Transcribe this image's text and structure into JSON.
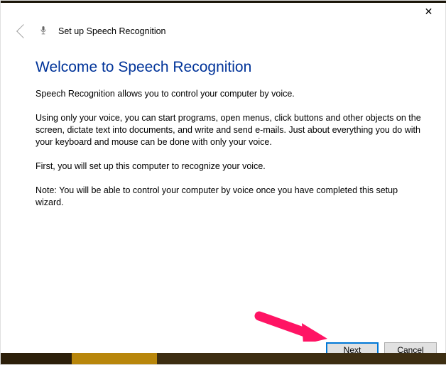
{
  "header": {
    "title": "Set up Speech Recognition"
  },
  "content": {
    "heading": "Welcome to Speech Recognition",
    "paragraphs": [
      "Speech Recognition allows you to control your computer by voice.",
      "Using only your voice, you can start programs, open menus, click buttons and other objects on the screen, dictate text into documents, and write and send e-mails. Just about everything you do with your keyboard and mouse can be done with only your voice.",
      "First, you will set up this computer to recognize your voice.",
      "Note: You will be able to control your computer by voice once you have completed this setup wizard."
    ]
  },
  "footer": {
    "next": "Next",
    "cancel": "Cancel"
  },
  "colors": {
    "heading": "#003399",
    "accent": "#0078d7",
    "arrow": "#ff1464"
  }
}
